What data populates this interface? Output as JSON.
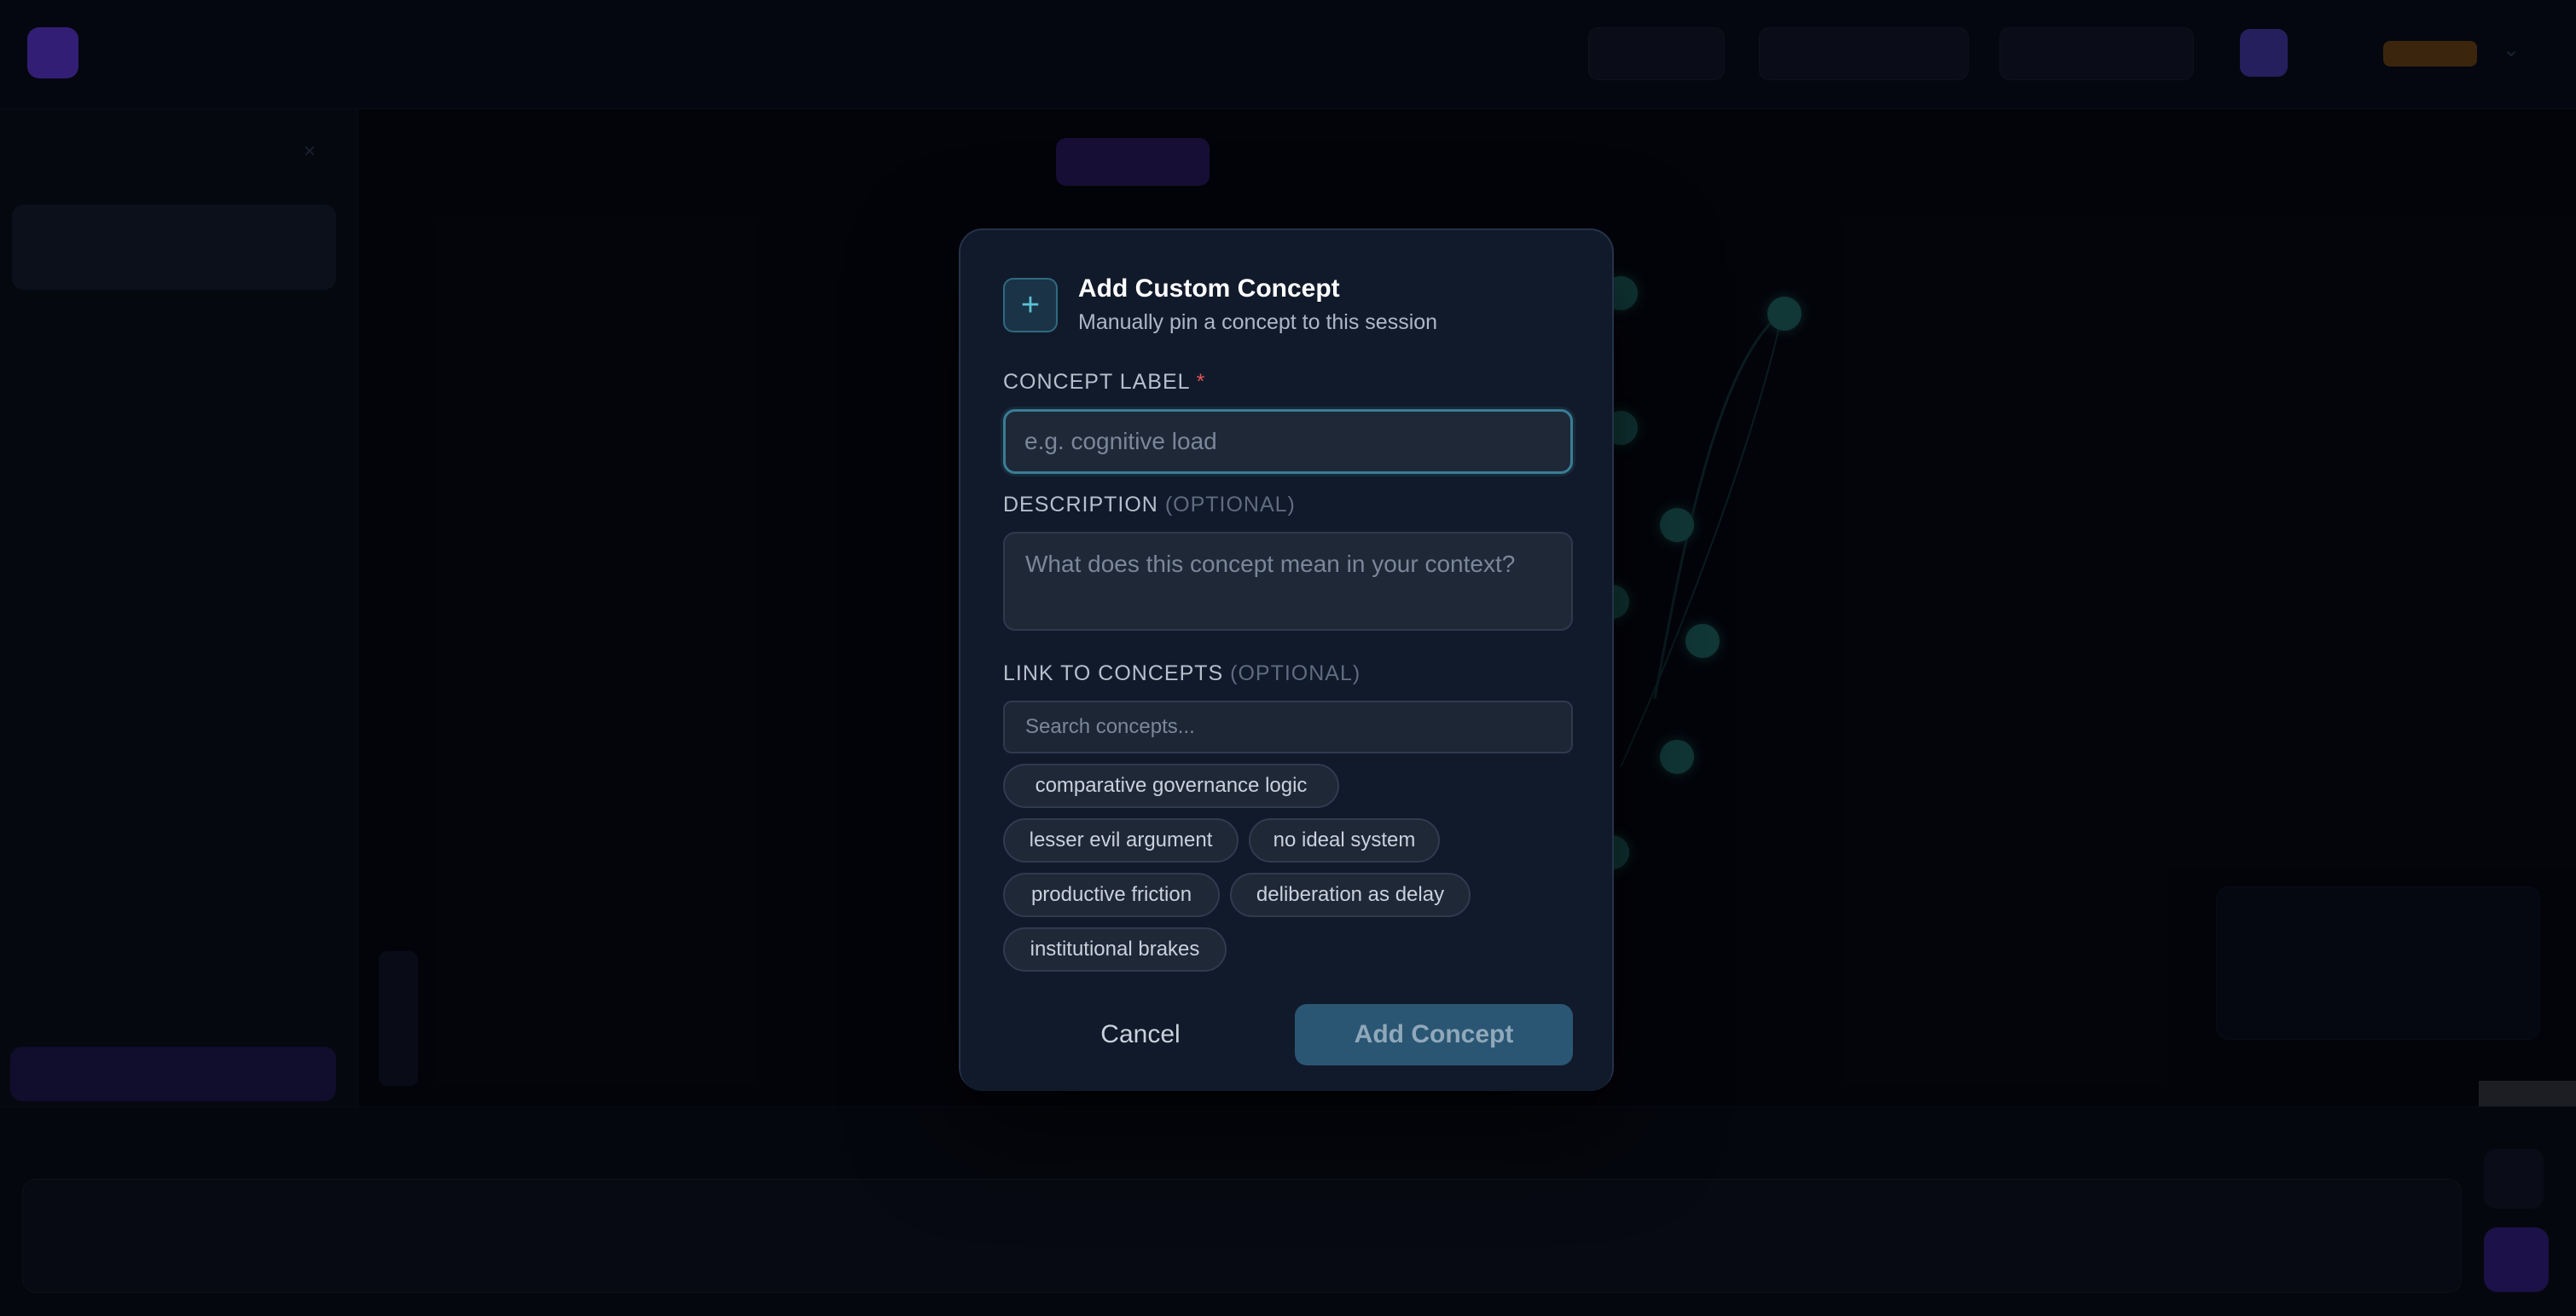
{
  "modal": {
    "icon": "plus-icon",
    "title": "Add Custom Concept",
    "subtitle": "Manually pin a concept to this session",
    "label_field": {
      "label": "CONCEPT LABEL",
      "required_mark": "*",
      "placeholder": "e.g. cognitive load",
      "value": ""
    },
    "description_field": {
      "label": "DESCRIPTION",
      "optional_tag": "(OPTIONAL)",
      "placeholder": "What does this concept mean in your context?",
      "value": ""
    },
    "link_field": {
      "label": "LINK TO CONCEPTS",
      "optional_tag": "(OPTIONAL)",
      "placeholder": "Search concepts...",
      "value": ""
    },
    "concept_chips": [
      "comparative governance logic",
      "lesser evil argument",
      "no ideal system",
      "productive friction",
      "deliberation as delay",
      "institutional brakes"
    ],
    "cancel_label": "Cancel",
    "submit_label": "Add Concept"
  },
  "colors": {
    "accent": "#3a7d96",
    "modal_bg": "#111a2a",
    "submit_bg": "#2a5673",
    "required": "#e05555"
  }
}
